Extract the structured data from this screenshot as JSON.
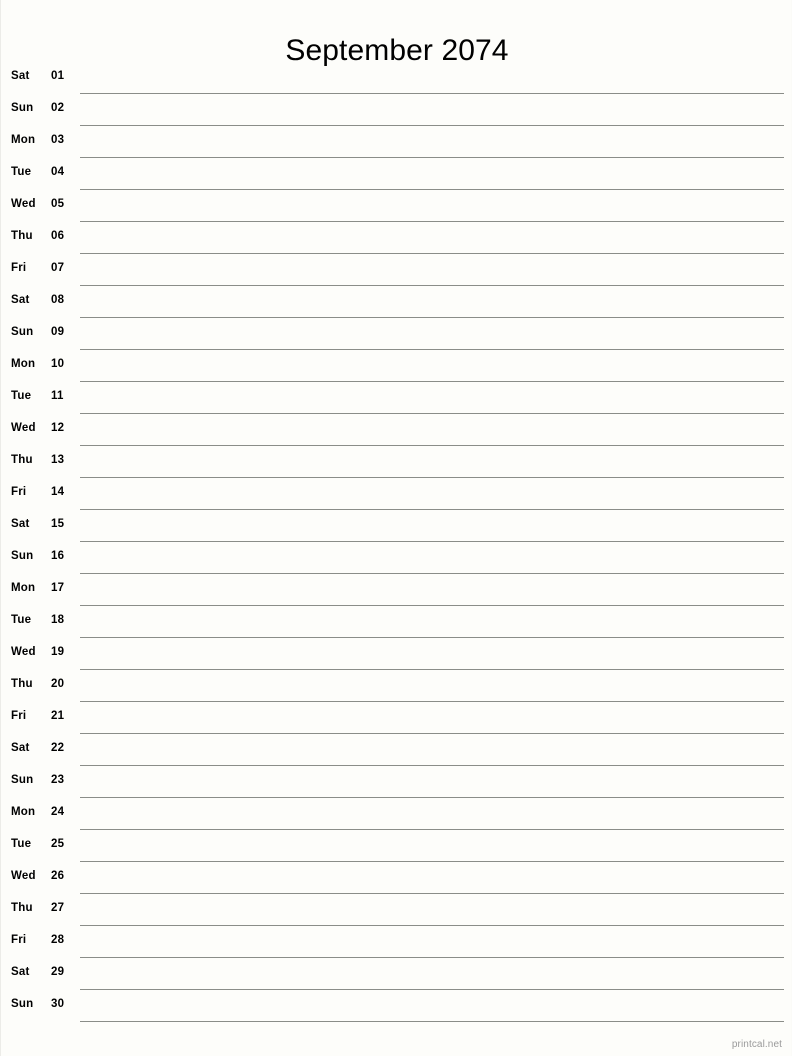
{
  "calendar": {
    "title": "September 2074",
    "month": "September",
    "year": "2074",
    "footer_credit": "printcal.net",
    "line_color": "#8a8d88",
    "background_color": "#fdfdfa",
    "text_color": "#000000",
    "footer_color": "#9a9a9a",
    "days": [
      {
        "weekday": "Sat",
        "number": "01"
      },
      {
        "weekday": "Sun",
        "number": "02"
      },
      {
        "weekday": "Mon",
        "number": "03"
      },
      {
        "weekday": "Tue",
        "number": "04"
      },
      {
        "weekday": "Wed",
        "number": "05"
      },
      {
        "weekday": "Thu",
        "number": "06"
      },
      {
        "weekday": "Fri",
        "number": "07"
      },
      {
        "weekday": "Sat",
        "number": "08"
      },
      {
        "weekday": "Sun",
        "number": "09"
      },
      {
        "weekday": "Mon",
        "number": "10"
      },
      {
        "weekday": "Tue",
        "number": "11"
      },
      {
        "weekday": "Wed",
        "number": "12"
      },
      {
        "weekday": "Thu",
        "number": "13"
      },
      {
        "weekday": "Fri",
        "number": "14"
      },
      {
        "weekday": "Sat",
        "number": "15"
      },
      {
        "weekday": "Sun",
        "number": "16"
      },
      {
        "weekday": "Mon",
        "number": "17"
      },
      {
        "weekday": "Tue",
        "number": "18"
      },
      {
        "weekday": "Wed",
        "number": "19"
      },
      {
        "weekday": "Thu",
        "number": "20"
      },
      {
        "weekday": "Fri",
        "number": "21"
      },
      {
        "weekday": "Sat",
        "number": "22"
      },
      {
        "weekday": "Sun",
        "number": "23"
      },
      {
        "weekday": "Mon",
        "number": "24"
      },
      {
        "weekday": "Tue",
        "number": "25"
      },
      {
        "weekday": "Wed",
        "number": "26"
      },
      {
        "weekday": "Thu",
        "number": "27"
      },
      {
        "weekday": "Fri",
        "number": "28"
      },
      {
        "weekday": "Sat",
        "number": "29"
      },
      {
        "weekday": "Sun",
        "number": "30"
      }
    ]
  }
}
